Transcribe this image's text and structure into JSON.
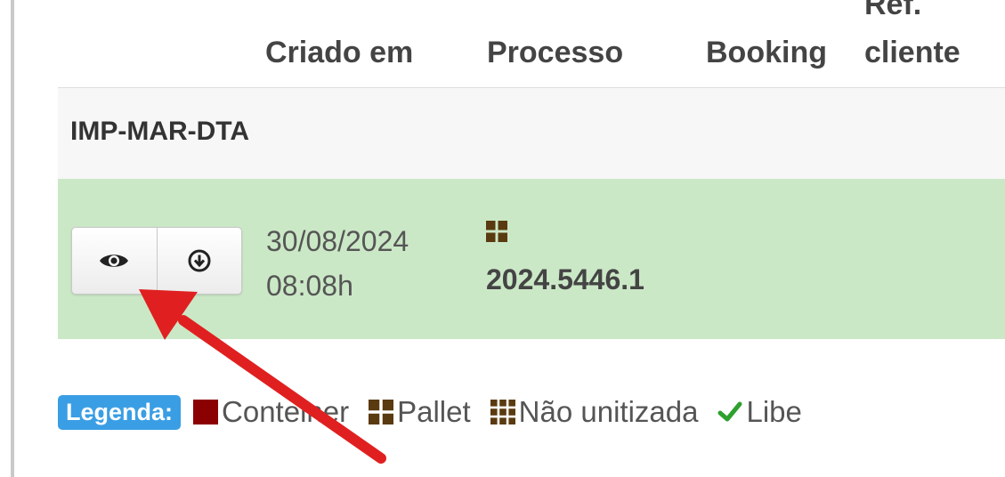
{
  "table": {
    "headers": {
      "created": "Criado em",
      "process": "Processo",
      "booking": "Booking",
      "ref_top": "Ref.",
      "ref_bottom": "cliente"
    },
    "group_label": "IMP-MAR-DTA",
    "row": {
      "date": "30/08/2024",
      "time": "08:08h",
      "process_number": "2024.5446.1",
      "process_type_icon": "pallet-icon",
      "row_color": "#cbe8c6"
    },
    "actions": {
      "view_icon": "eye-icon",
      "download_icon": "download-circle-icon"
    }
  },
  "legend": {
    "label": "Legenda:",
    "items": [
      {
        "icon": "container-icon",
        "label": "Conteiner",
        "color": "#8b0000"
      },
      {
        "icon": "pallet-icon",
        "label": "Pallet",
        "color": "#5a3a10"
      },
      {
        "icon": "grid-icon",
        "label": "Não unitizada",
        "color": "#5a3a10"
      },
      {
        "icon": "check-icon",
        "label": "Libe",
        "color": "#2ea02e"
      }
    ]
  },
  "colors": {
    "badge": "#3a9ee4",
    "annotation_arrow": "#e02020"
  }
}
